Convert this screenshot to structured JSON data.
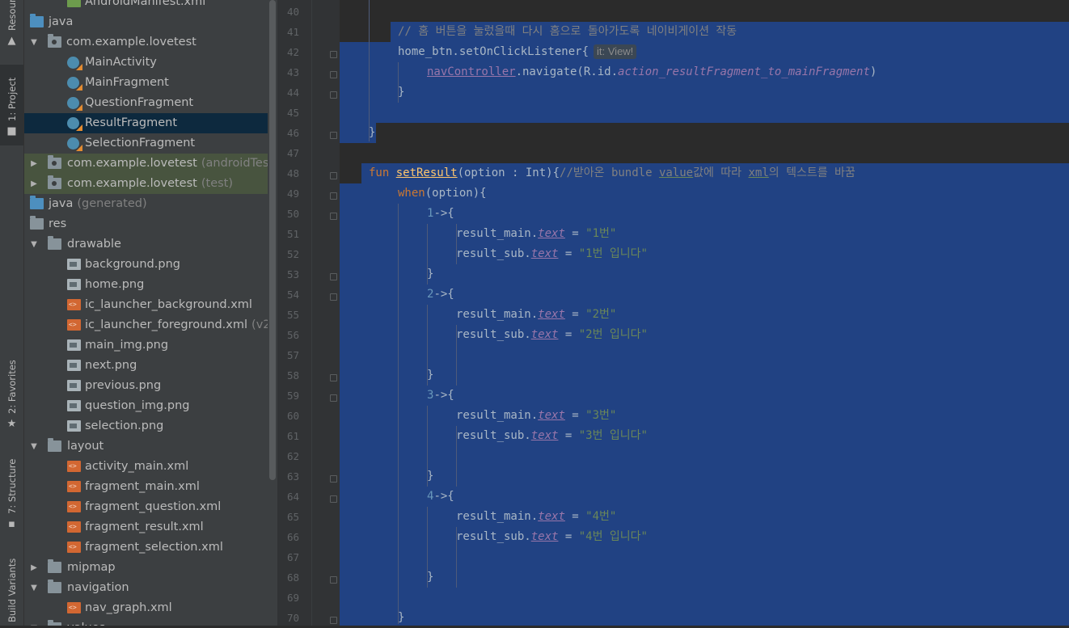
{
  "tool_stripe": {
    "resource_manager": "Resource Manager",
    "project": "1: Project",
    "favorites": "2: Favorites",
    "structure": "7: Structure",
    "build_variants": "Build Variants"
  },
  "project_tree": [
    {
      "label": "AndroidManifest.xml",
      "icon": "manifest-icon"
    },
    {
      "label": "java",
      "icon": "folder-icon"
    },
    {
      "label": "com.example.lovetest",
      "icon": "package-icon",
      "arrow": "expanded"
    },
    {
      "label": "MainActivity",
      "icon": "kotlin-class-icon"
    },
    {
      "label": "MainFragment",
      "icon": "kotlin-class-icon"
    },
    {
      "label": "QuestionFragment",
      "icon": "kotlin-class-icon"
    },
    {
      "label": "ResultFragment",
      "icon": "kotlin-class-icon",
      "selected": true
    },
    {
      "label": "SelectionFragment",
      "icon": "kotlin-class-icon"
    },
    {
      "label": "com.example.lovetest",
      "suffix": "(androidTest)",
      "icon": "package-icon",
      "arrow": "collapsed"
    },
    {
      "label": "com.example.lovetest",
      "suffix": "(test)",
      "icon": "package-icon",
      "arrow": "collapsed"
    },
    {
      "label": "java",
      "suffix": "(generated)",
      "icon": "generated-folder-icon"
    },
    {
      "label": "res",
      "icon": "folder-icon"
    },
    {
      "label": "drawable",
      "icon": "folder-icon",
      "arrow": "expanded"
    },
    {
      "label": "background.png",
      "icon": "image-file-icon"
    },
    {
      "label": "home.png",
      "icon": "image-file-icon"
    },
    {
      "label": "ic_launcher_background.xml",
      "icon": "xml-file-icon"
    },
    {
      "label": "ic_launcher_foreground.xml",
      "suffix": "(v24)",
      "icon": "xml-file-icon"
    },
    {
      "label": "main_img.png",
      "icon": "image-file-icon"
    },
    {
      "label": "next.png",
      "icon": "image-file-icon"
    },
    {
      "label": "previous.png",
      "icon": "image-file-icon"
    },
    {
      "label": "question_img.png",
      "icon": "image-file-icon"
    },
    {
      "label": "selection.png",
      "icon": "image-file-icon"
    },
    {
      "label": "layout",
      "icon": "folder-icon",
      "arrow": "expanded"
    },
    {
      "label": "activity_main.xml",
      "icon": "xml-file-icon"
    },
    {
      "label": "fragment_main.xml",
      "icon": "xml-file-icon"
    },
    {
      "label": "fragment_question.xml",
      "icon": "xml-file-icon"
    },
    {
      "label": "fragment_result.xml",
      "icon": "xml-file-icon"
    },
    {
      "label": "fragment_selection.xml",
      "icon": "xml-file-icon"
    },
    {
      "label": "mipmap",
      "icon": "folder-icon",
      "arrow": "collapsed"
    },
    {
      "label": "navigation",
      "icon": "folder-icon",
      "arrow": "expanded"
    },
    {
      "label": "nav_graph.xml",
      "icon": "xml-file-icon"
    },
    {
      "label": "values",
      "icon": "folder-icon",
      "arrow": "expanded"
    }
  ],
  "editor": {
    "lines": [
      {
        "n": "40",
        "tokens": []
      },
      {
        "n": "41",
        "tokens": [
          {
            "t": "// 홈 버튼을 눌렀을때 다시 홈으로 돌아가도록 네이비게이션 작동",
            "c": "cm"
          }
        ]
      },
      {
        "n": "42",
        "tokens": [
          {
            "t": "home_btn.setOnClickListener{"
          }
        ],
        "hint": "it: View!"
      },
      {
        "n": "43",
        "tokens": [
          {
            "t": "navController",
            "c": "prop und"
          },
          {
            "t": ".navigate(R.id."
          },
          {
            "t": "action_resultFragment_to_mainFragment",
            "c": "prop ital"
          },
          {
            "t": ")"
          }
        ]
      },
      {
        "n": "44",
        "tokens": [
          {
            "t": "}"
          }
        ]
      },
      {
        "n": "45",
        "tokens": []
      },
      {
        "n": "46",
        "tokens": [
          {
            "t": "}"
          }
        ]
      },
      {
        "n": "47",
        "tokens": []
      },
      {
        "n": "48",
        "tokens": [
          {
            "t": "fun ",
            "c": "kw"
          },
          {
            "t": "setResult",
            "c": "fn und"
          },
          {
            "t": "(option : Int){"
          },
          {
            "t": "//받아온 bundle ",
            "c": "cm"
          },
          {
            "t": "value",
            "c": "cm spell"
          },
          {
            "t": "값에 따라 ",
            "c": "cm"
          },
          {
            "t": "xml",
            "c": "cm spell"
          },
          {
            "t": "의 텍스트를 바꿈",
            "c": "cm"
          }
        ]
      },
      {
        "n": "49",
        "tokens": [
          {
            "t": "when",
            "c": "kw"
          },
          {
            "t": "(option){"
          }
        ]
      },
      {
        "n": "50",
        "tokens": [
          {
            "t": "1",
            "c": "num"
          },
          {
            "t": "->{"
          }
        ]
      },
      {
        "n": "51",
        "tokens": [
          {
            "t": "result_main."
          },
          {
            "t": "text",
            "c": "prop ital und"
          },
          {
            "t": " = "
          },
          {
            "t": "\"1번\"",
            "c": "str"
          }
        ]
      },
      {
        "n": "52",
        "tokens": [
          {
            "t": "result_sub."
          },
          {
            "t": "text",
            "c": "prop ital und"
          },
          {
            "t": " = "
          },
          {
            "t": "\"1번 입니다\"",
            "c": "str"
          }
        ]
      },
      {
        "n": "53",
        "tokens": [
          {
            "t": "}"
          }
        ]
      },
      {
        "n": "54",
        "tokens": [
          {
            "t": "2",
            "c": "num"
          },
          {
            "t": "->{"
          }
        ]
      },
      {
        "n": "55",
        "tokens": [
          {
            "t": "result_main."
          },
          {
            "t": "text",
            "c": "prop ital und"
          },
          {
            "t": " = "
          },
          {
            "t": "\"2번\"",
            "c": "str"
          }
        ]
      },
      {
        "n": "56",
        "tokens": [
          {
            "t": "result_sub."
          },
          {
            "t": "text",
            "c": "prop ital und"
          },
          {
            "t": " = "
          },
          {
            "t": "\"2번 입니다\"",
            "c": "str"
          }
        ]
      },
      {
        "n": "57",
        "tokens": []
      },
      {
        "n": "58",
        "tokens": [
          {
            "t": "}"
          }
        ]
      },
      {
        "n": "59",
        "tokens": [
          {
            "t": "3",
            "c": "num"
          },
          {
            "t": "->{"
          }
        ]
      },
      {
        "n": "60",
        "tokens": [
          {
            "t": "result_main."
          },
          {
            "t": "text",
            "c": "prop ital und"
          },
          {
            "t": " = "
          },
          {
            "t": "\"3번\"",
            "c": "str"
          }
        ]
      },
      {
        "n": "61",
        "tokens": [
          {
            "t": "result_sub."
          },
          {
            "t": "text",
            "c": "prop ital und"
          },
          {
            "t": " = "
          },
          {
            "t": "\"3번 입니다\"",
            "c": "str"
          }
        ]
      },
      {
        "n": "62",
        "tokens": []
      },
      {
        "n": "63",
        "tokens": [
          {
            "t": "}"
          }
        ]
      },
      {
        "n": "64",
        "tokens": [
          {
            "t": "4",
            "c": "num"
          },
          {
            "t": "->{"
          }
        ]
      },
      {
        "n": "65",
        "tokens": [
          {
            "t": "result_main."
          },
          {
            "t": "text",
            "c": "prop ital und"
          },
          {
            "t": " = "
          },
          {
            "t": "\"4번\"",
            "c": "str"
          }
        ]
      },
      {
        "n": "66",
        "tokens": [
          {
            "t": "result_sub."
          },
          {
            "t": "text",
            "c": "prop ital und"
          },
          {
            "t": " = "
          },
          {
            "t": "\"4번 입니다\"",
            "c": "str"
          }
        ]
      },
      {
        "n": "67",
        "tokens": []
      },
      {
        "n": "68",
        "tokens": [
          {
            "t": "}"
          }
        ]
      },
      {
        "n": "69",
        "tokens": []
      },
      {
        "n": "70",
        "tokens": [
          {
            "t": "}"
          }
        ]
      }
    ]
  },
  "colors": {
    "selection": "#214283",
    "tree_selected": "#0d293e",
    "tree_tinted": "#48543f",
    "keyword": "#cc7832",
    "function": "#ffc66d",
    "comment": "#808080",
    "string": "#6a8759",
    "number": "#6897bb",
    "property": "#9876aa"
  }
}
